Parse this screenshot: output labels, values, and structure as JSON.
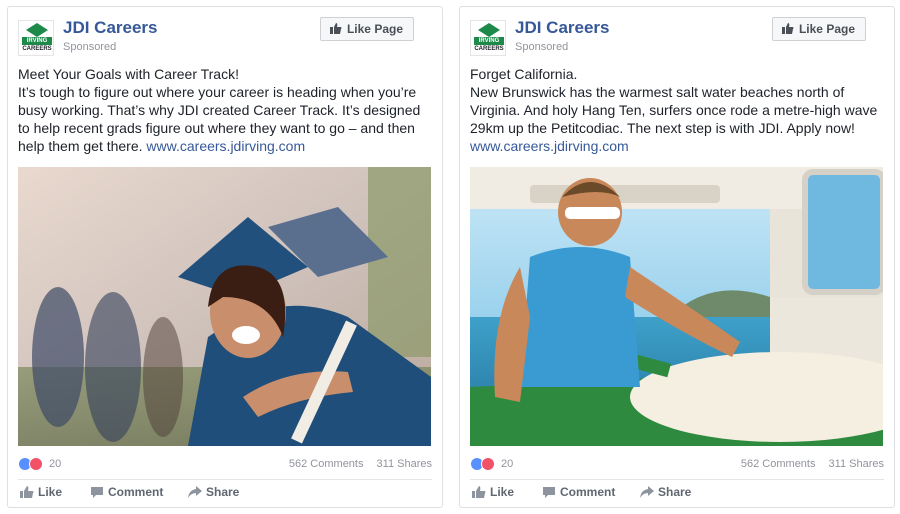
{
  "posts": [
    {
      "page_name": "JDI Careers",
      "sponsored": "Sponsored",
      "like_page_label": "Like Page",
      "logo_text_top": "IRVING",
      "logo_text_bottom": "CAREERS",
      "headline": "Meet Your Goals with Career Track!",
      "body": "It’s tough to figure out where your career is heading when you’re busy working. That’s why JDI created Career Track. It’s designed to help recent grads figure out where they want to go – and then help them get there.",
      "url": "www.careers.jdirving.com",
      "reaction_count": "20",
      "comments": "562 Comments",
      "shares": "311 Shares",
      "actions": {
        "like": "Like",
        "comment": "Comment",
        "share": "Share"
      }
    },
    {
      "page_name": "JDI Careers",
      "sponsored": "Sponsored",
      "like_page_label": "Like Page",
      "logo_text_top": "IRVING",
      "logo_text_bottom": "CAREERS",
      "headline": "Forget California.",
      "body": "New Brunswick has the warmest salt water beaches north of Virginia. And holy Hang Ten, surfers once rode a metre-high wave 29km up the Petitcodiac. The next step is with JDI. Apply now!",
      "url": "www.careers.jdirving.com",
      "reaction_count": "20",
      "comments": "562 Comments",
      "shares": "311 Shares",
      "actions": {
        "like": "Like",
        "comment": "Comment",
        "share": "Share"
      }
    }
  ],
  "colors": {
    "link": "#365899",
    "brand_green": "#1d8a4a",
    "like_blue": "#5890ff",
    "love_red": "#f25268"
  }
}
